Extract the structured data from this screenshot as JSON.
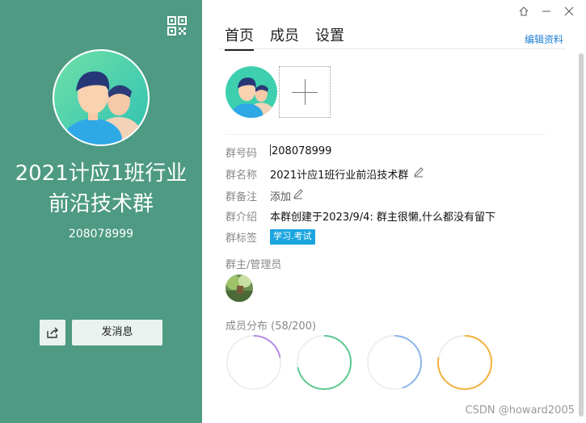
{
  "left_panel": {
    "group_name": "2021计应1班行业前沿技术群",
    "group_id": "208078999",
    "send_button": "发消息",
    "bg_color": "#4e9a83"
  },
  "window_controls": [
    "pin-icon",
    "minimize-icon",
    "close-icon"
  ],
  "tabs": [
    "首页",
    "成员",
    "设置"
  ],
  "edit_link": "编辑资料",
  "info": {
    "id_label": "群号码",
    "id_value": "208078999",
    "name_label": "群名称",
    "name_value": "2021计应1班行业前沿技术群",
    "note_label": "群备注",
    "note_value": "添加",
    "intro_label": "群介绍",
    "intro_value": "本群创建于2023/9/4:  群主很懒,什么都没有留下",
    "tag_label": "群标签",
    "tag_value": "学习.考试"
  },
  "admins_title": "群主/管理员",
  "members_title": "成员分布",
  "members_count": "(58/200)",
  "rings": [
    {
      "color": "#b88ce0",
      "fraction": 0.22
    },
    {
      "color": "#5cc98f",
      "fraction": 0.72
    },
    {
      "color": "#8ab6e8",
      "fraction": 0.45
    },
    {
      "color": "#f2b23c",
      "fraction": 0.78
    }
  ],
  "watermark": "CSDN @howard2005"
}
